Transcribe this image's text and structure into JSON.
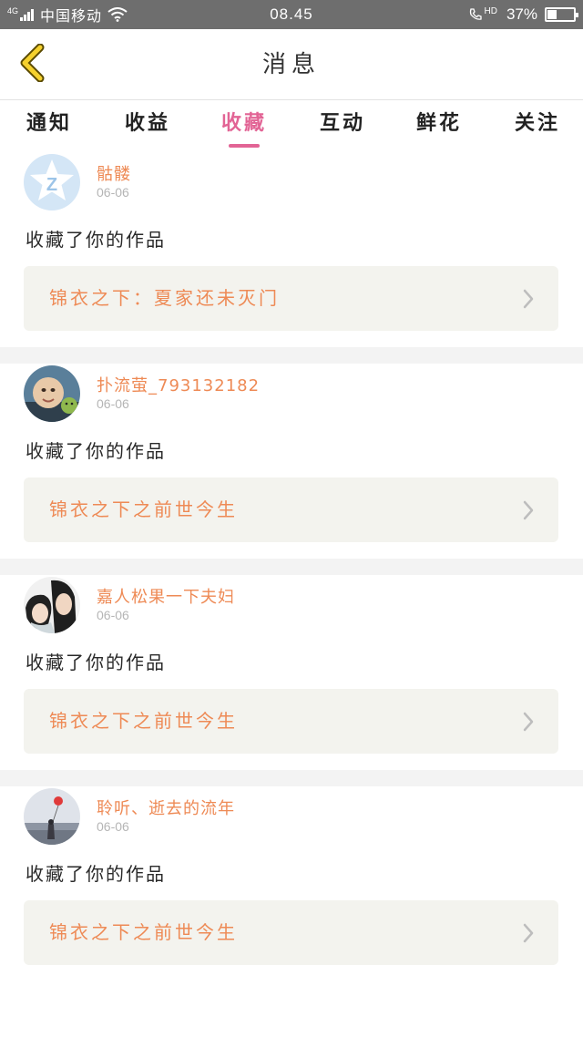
{
  "status_bar": {
    "network": "4G",
    "carrier": "中国移动",
    "time": "08.45",
    "hd": "HD",
    "battery_text": "37%",
    "battery_level": 0.37
  },
  "nav": {
    "title": "消息"
  },
  "tabs": [
    {
      "label": "通知"
    },
    {
      "label": "收益"
    },
    {
      "label": "收藏",
      "active": true
    },
    {
      "label": "互动"
    },
    {
      "label": "鲜花"
    },
    {
      "label": "关注"
    }
  ],
  "messages": [
    {
      "user": "骷髅",
      "date": "06-06",
      "text": "收藏了你的作品",
      "work": "锦衣之下：夏家还未灭门",
      "avatar": "qq-default-avatar"
    },
    {
      "user": "扑流萤_793132182",
      "date": "06-06",
      "text": "收藏了你的作品",
      "work": "锦衣之下之前世今生",
      "avatar": "child-photo-avatar"
    },
    {
      "user": "嘉人松果一下夫妇",
      "date": "06-06",
      "text": "收藏了你的作品",
      "work": "锦衣之下之前世今生",
      "avatar": "couple-photo-avatar"
    },
    {
      "user": "聆听、逝去的流年",
      "date": "06-06",
      "text": "收藏了你的作品",
      "work": "锦衣之下之前世今生",
      "avatar": "balloon-photo-avatar"
    }
  ],
  "colors": {
    "accent_pink": "#e26495",
    "orange_text": "#ee8a55",
    "back_arrow": "#f5d12e"
  }
}
